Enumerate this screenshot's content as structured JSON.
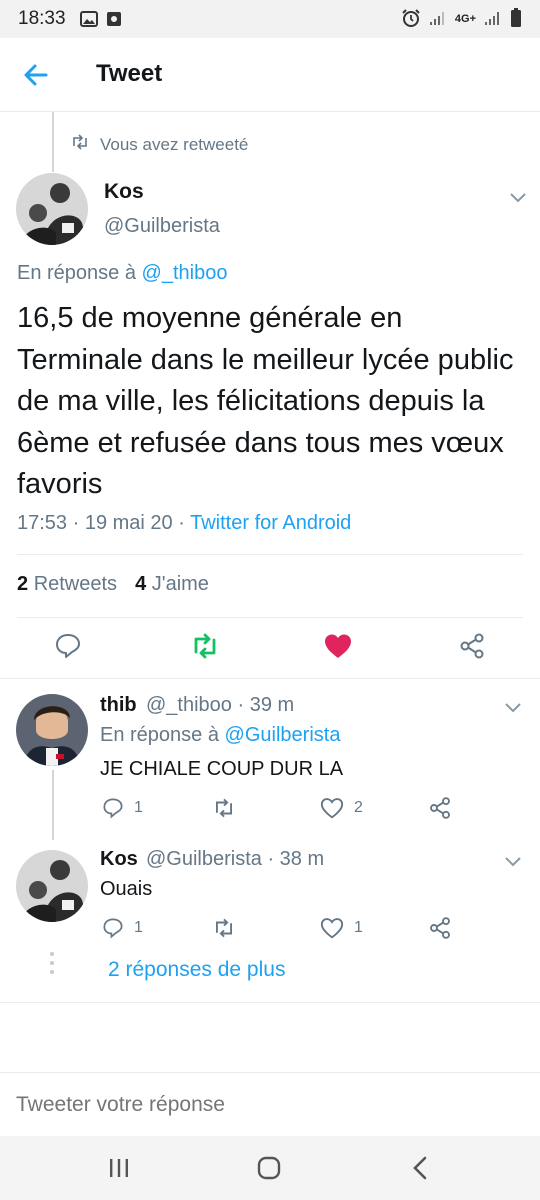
{
  "status": {
    "time": "18:33",
    "network": "4G+"
  },
  "header": {
    "title": "Tweet"
  },
  "retweet": {
    "label": "Vous avez retweeté"
  },
  "tweet": {
    "name": "Kos",
    "handle": "@Guilberista",
    "reply_prefix": "En réponse à",
    "reply_to": "@_thiboo",
    "text": "16,5 de moyenne générale en Terminale dans le meilleur lycée public de ma ville, les félicitations depuis la 6ème et refusée dans tous mes vœux favoris",
    "time": "17:53",
    "date": "19 mai 20",
    "source": "Twitter for Android",
    "retweets_count": "2",
    "retweets_label": "Retweets",
    "likes_count": "4",
    "likes_label": "J'aime"
  },
  "colors": {
    "accent": "#1da1f2",
    "retweet_green": "#17bf63",
    "like_red": "#e0245e",
    "muted": "#657786"
  },
  "replies": [
    {
      "name": "thib",
      "handle": "@_thiboo",
      "time": "· 39 m",
      "reply_prefix": "En réponse à",
      "reply_to": "@Guilberista",
      "text": "JE CHIALE COUP DUR LA",
      "reply_count": "1",
      "like_count": "2"
    },
    {
      "name": "Kos",
      "handle": "@Guilberista",
      "time": "· 38 m",
      "text": "Ouais",
      "reply_count": "1",
      "like_count": "1"
    }
  ],
  "more_replies": "2 réponses de plus",
  "compose": {
    "placeholder": "Tweeter votre réponse"
  }
}
